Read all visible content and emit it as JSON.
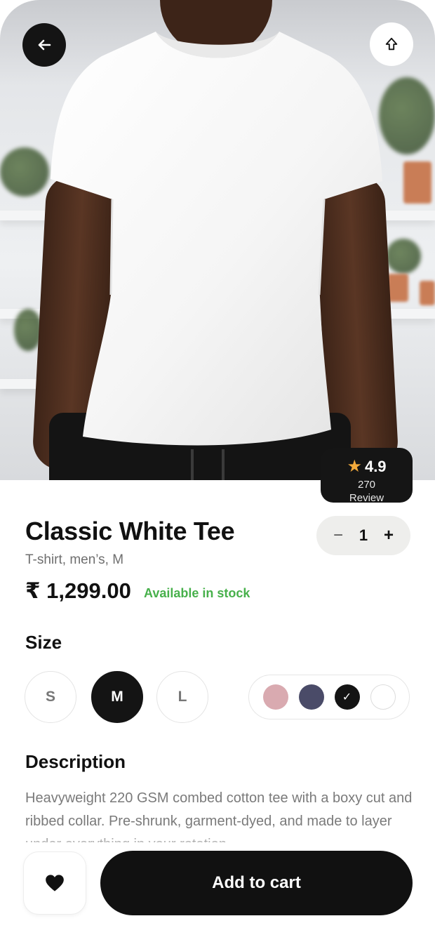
{
  "header": {
    "back_icon": "arrow-left-icon",
    "share_icon": "share-upload-icon"
  },
  "rating": {
    "star_icon": "star-icon",
    "value": "4.9",
    "count": "270",
    "label": "Review"
  },
  "product": {
    "title": "Classic White Tee",
    "subtitle": "T-shirt, men’s, M",
    "price": "₹ 1,299.00",
    "stock": "Available in stock",
    "stock_color": "#47b04b"
  },
  "quantity": {
    "minus": "−",
    "value": "1",
    "plus": "+"
  },
  "size": {
    "heading": "Size",
    "options": [
      "S",
      "M",
      "L"
    ],
    "selected": "M"
  },
  "colors": {
    "swatches": [
      {
        "name": "pink",
        "hex": "#d9aab0"
      },
      {
        "name": "navy",
        "hex": "#4a4b68"
      },
      {
        "name": "black",
        "hex": "#141414"
      },
      {
        "name": "white",
        "hex": "#ffffff"
      }
    ],
    "selected": "black",
    "check_icon": "check-icon"
  },
  "description": {
    "heading": "Description",
    "text": "Heavyweight 220 GSM combed cotton tee with a boxy cut and ribbed collar. Pre-shrunk, garment-dyed, and made to layer under everything in your rotation."
  },
  "actions": {
    "favorite_icon": "heart-icon",
    "add_to_cart": "Add to cart"
  }
}
